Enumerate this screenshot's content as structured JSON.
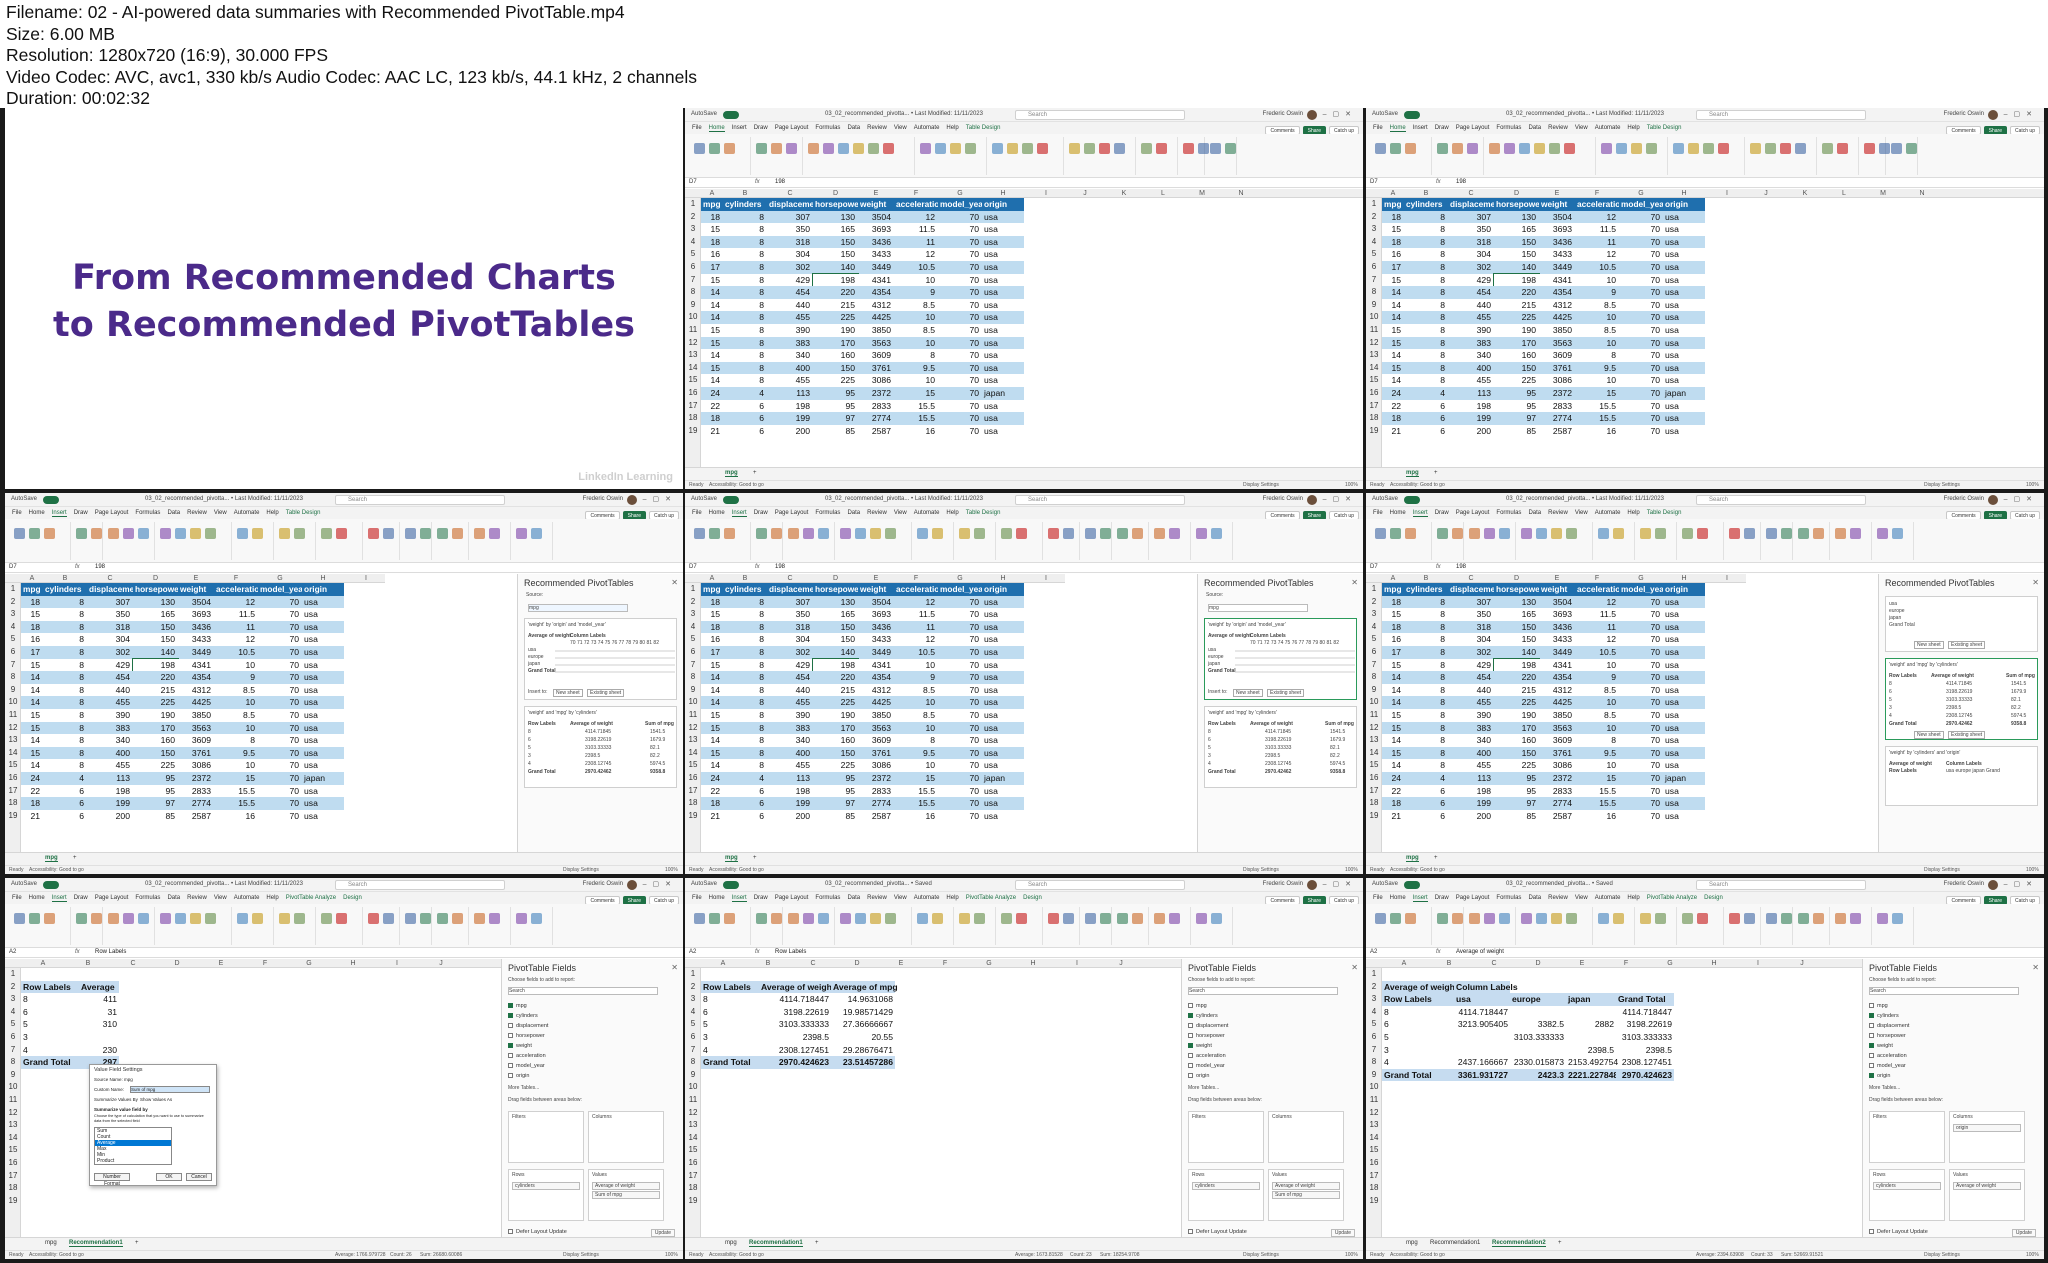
{
  "meta": {
    "filename": "Filename: 02 - AI-powered data summaries with Recommended PivotTable.mp4",
    "size": "Size: 6.00 MB",
    "resolution": "Resolution: 1280x720 (16:9), 30.000 FPS",
    "codec": "Video Codec: AVC, avc1, 330 kb/s Audio Codec: AAC LC, 123 kb/s, 44.1 kHz, 2 channels",
    "duration": "Duration: 00:02:32"
  },
  "title_card": {
    "line1": "From Recommended Charts",
    "line2": "to Recommended PivotTables",
    "watermark": "LinkedIn Learning"
  },
  "excel": {
    "autosave": "AutoSave",
    "file_name": "03_02_recommended_pivotta... • Last Modified: 11/11/2023",
    "file_name_saved": "03_02_recommended_pivotta... • Saved",
    "search": "Search",
    "user": "Frederic Oswin",
    "name_box": "D7",
    "name_box_a2": "A2",
    "formula_value": "198",
    "formula_row_labels": "Row Labels",
    "formula_avg_weight": "Average of weight",
    "menu": [
      "File",
      "Home",
      "Insert",
      "Draw",
      "Page Layout",
      "Formulas",
      "Data",
      "Review",
      "View",
      "Automate",
      "Help"
    ],
    "ctx_table": "Table Design",
    "ctx_pivot": "PivotTable Analyze",
    "ctx_design": "Design",
    "btn_comments": "Comments",
    "btn_share": "Share",
    "btn_catchup": "Catch up",
    "sheet_mpg": "mpg",
    "sheet_rec1": "Recommendation1",
    "sheet_rec2": "Recommendation2",
    "status_ready": "Ready",
    "status_access": "Accessibility: Good to go",
    "status_display": "Display Settings",
    "zoom": "100%"
  },
  "sheet": {
    "columns": [
      "A",
      "B",
      "C",
      "D",
      "E",
      "F",
      "G",
      "H",
      "I",
      "J",
      "K",
      "L",
      "M",
      "N"
    ],
    "headers": [
      "mpg",
      "cylinders",
      "displacement",
      "horsepower",
      "weight",
      "acceleration",
      "model_year",
      "origin"
    ],
    "rows": [
      [
        "18",
        "8",
        "307",
        "130",
        "3504",
        "12",
        "70",
        "usa"
      ],
      [
        "15",
        "8",
        "350",
        "165",
        "3693",
        "11.5",
        "70",
        "usa"
      ],
      [
        "18",
        "8",
        "318",
        "150",
        "3436",
        "11",
        "70",
        "usa"
      ],
      [
        "16",
        "8",
        "304",
        "150",
        "3433",
        "12",
        "70",
        "usa"
      ],
      [
        "17",
        "8",
        "302",
        "140",
        "3449",
        "10.5",
        "70",
        "usa"
      ],
      [
        "15",
        "8",
        "429",
        "198",
        "4341",
        "10",
        "70",
        "usa"
      ],
      [
        "14",
        "8",
        "454",
        "220",
        "4354",
        "9",
        "70",
        "usa"
      ],
      [
        "14",
        "8",
        "440",
        "215",
        "4312",
        "8.5",
        "70",
        "usa"
      ],
      [
        "14",
        "8",
        "455",
        "225",
        "4425",
        "10",
        "70",
        "usa"
      ],
      [
        "15",
        "8",
        "390",
        "190",
        "3850",
        "8.5",
        "70",
        "usa"
      ],
      [
        "15",
        "8",
        "383",
        "170",
        "3563",
        "10",
        "70",
        "usa"
      ],
      [
        "14",
        "8",
        "340",
        "160",
        "3609",
        "8",
        "70",
        "usa"
      ],
      [
        "15",
        "8",
        "400",
        "150",
        "3761",
        "9.5",
        "70",
        "usa"
      ],
      [
        "14",
        "8",
        "455",
        "225",
        "3086",
        "10",
        "70",
        "usa"
      ],
      [
        "24",
        "4",
        "113",
        "95",
        "2372",
        "15",
        "70",
        "japan"
      ],
      [
        "22",
        "6",
        "198",
        "95",
        "2833",
        "15.5",
        "70",
        "usa"
      ],
      [
        "18",
        "6",
        "199",
        "97",
        "2774",
        "15.5",
        "70",
        "usa"
      ],
      [
        "21",
        "6",
        "200",
        "85",
        "2587",
        "16",
        "70",
        "usa"
      ]
    ]
  },
  "rec_pane": {
    "title": "Recommended PivotTables",
    "source_label": "Source:",
    "source_value": "mpg",
    "card1_caption": "'weight' by 'origin' and 'model_year'",
    "card1_h1": "Average of weight",
    "card1_h2": "Column Labels",
    "card1_years": "70 71 72 73 74 75 76 77 78 79 80 81 82",
    "card1_rows": [
      "usa",
      "europe",
      "japan",
      "Grand Total"
    ],
    "insert_to": "Insert to:",
    "new_sheet": "New sheet",
    "existing_sheet": "Existing sheet",
    "card2_caption": "'weight' and 'mpg' by 'cylinders'",
    "card2_h1": "Row Labels",
    "card2_h2": "Average of weight",
    "card2_h3": "Sum of mpg",
    "card2_rows": [
      [
        "8",
        "4114.71845",
        "1541.5"
      ],
      [
        "6",
        "3198.22619",
        "1679.9"
      ],
      [
        "5",
        "3103.33333",
        "82.1"
      ],
      [
        "3",
        "2398.5",
        "82.2"
      ],
      [
        "4",
        "2308.12745",
        "5974.5"
      ],
      [
        "Grand Total",
        "2970.42462",
        "9358.8"
      ]
    ],
    "card3_caption": "'weight' by 'cylinders' and 'origin'",
    "card3_cols": "usa europe japan Grand"
  },
  "pivot1": {
    "row_labels": "Row Labels",
    "avg_weight_short": "Average",
    "rows": [
      [
        "8",
        "411"
      ],
      [
        "6",
        "31"
      ],
      [
        "5",
        "310"
      ],
      [
        "3",
        ""
      ],
      [
        "4",
        "230"
      ],
      [
        "Grand Total",
        "297"
      ]
    ]
  },
  "dialog": {
    "title": "Value Field Settings",
    "source_name": "Source Name: mpg",
    "custom_name": "Custom Name:",
    "custom_value": "Sum of mpg",
    "tab1": "Summarize Values By",
    "tab2": "Show Values As",
    "heading": "Summarize value field by",
    "hint": "Choose the type of calculation that you want to use to summarize data from the selected field",
    "options": [
      "Sum",
      "Count",
      "Average",
      "Max",
      "Min",
      "Product"
    ],
    "number_format": "Number Format",
    "ok": "OK",
    "cancel": "Cancel"
  },
  "pivot2": {
    "headers": [
      "Row Labels",
      "Average of weight",
      "Average of mpg"
    ],
    "rows": [
      [
        "8",
        "4114.718447",
        "14.9631068"
      ],
      [
        "6",
        "3198.22619",
        "19.98571429"
      ],
      [
        "5",
        "3103.333333",
        "27.36666667"
      ],
      [
        "3",
        "2398.5",
        "20.55"
      ],
      [
        "4",
        "2308.127451",
        "29.28676471"
      ],
      [
        "Grand Total",
        "2970.424623",
        "23.51457286"
      ]
    ]
  },
  "pivot3": {
    "h1": [
      "Average of weight",
      "Column Labels"
    ],
    "h2": [
      "Row Labels",
      "usa",
      "europe",
      "japan",
      "Grand Total"
    ],
    "rows": [
      [
        "8",
        "4114.718447",
        "",
        "",
        "4114.718447"
      ],
      [
        "6",
        "3213.905405",
        "3382.5",
        "2882",
        "3198.22619"
      ],
      [
        "5",
        "",
        "3103.333333",
        "",
        "3103.333333"
      ],
      [
        "3",
        "",
        "",
        "2398.5",
        "2398.5"
      ],
      [
        "4",
        "2437.166667",
        "2330.015873",
        "2153.492754",
        "2308.127451"
      ],
      [
        "Grand Total",
        "3361.931727",
        "2423.3",
        "2221.227848",
        "2970.424623"
      ]
    ]
  },
  "fields_pane": {
    "title": "PivotTable Fields",
    "choose": "Choose fields to add to report:",
    "search": "Search",
    "fields": [
      "mpg",
      "cylinders",
      "displacement",
      "horsepower",
      "weight",
      "acceleration",
      "model_year",
      "origin"
    ],
    "more": "More Tables...",
    "drag": "Drag fields between areas below:",
    "filters": "Filters",
    "columns": "Columns",
    "rows": "Rows",
    "values": "Values",
    "sigma_values": "Σ Values",
    "row_field": "cylinders",
    "col_field": "origin",
    "val1": "Average of weight",
    "val2": "Sum of mpg",
    "defer": "Defer Layout Update",
    "update": "Update"
  },
  "status_calc1": {
    "avg": "Average: 1766.979728",
    "count": "Count: 26",
    "sum": "Sum: 26680.60086"
  },
  "status_calc2": {
    "avg": "Average: 1673.81528",
    "count": "Count: 23",
    "sum": "Sum: 18254.9708"
  },
  "status_calc3": {
    "avg": "Average: 2394.63908",
    "count": "Count: 33",
    "sum": "Sum: 52669.91521"
  }
}
